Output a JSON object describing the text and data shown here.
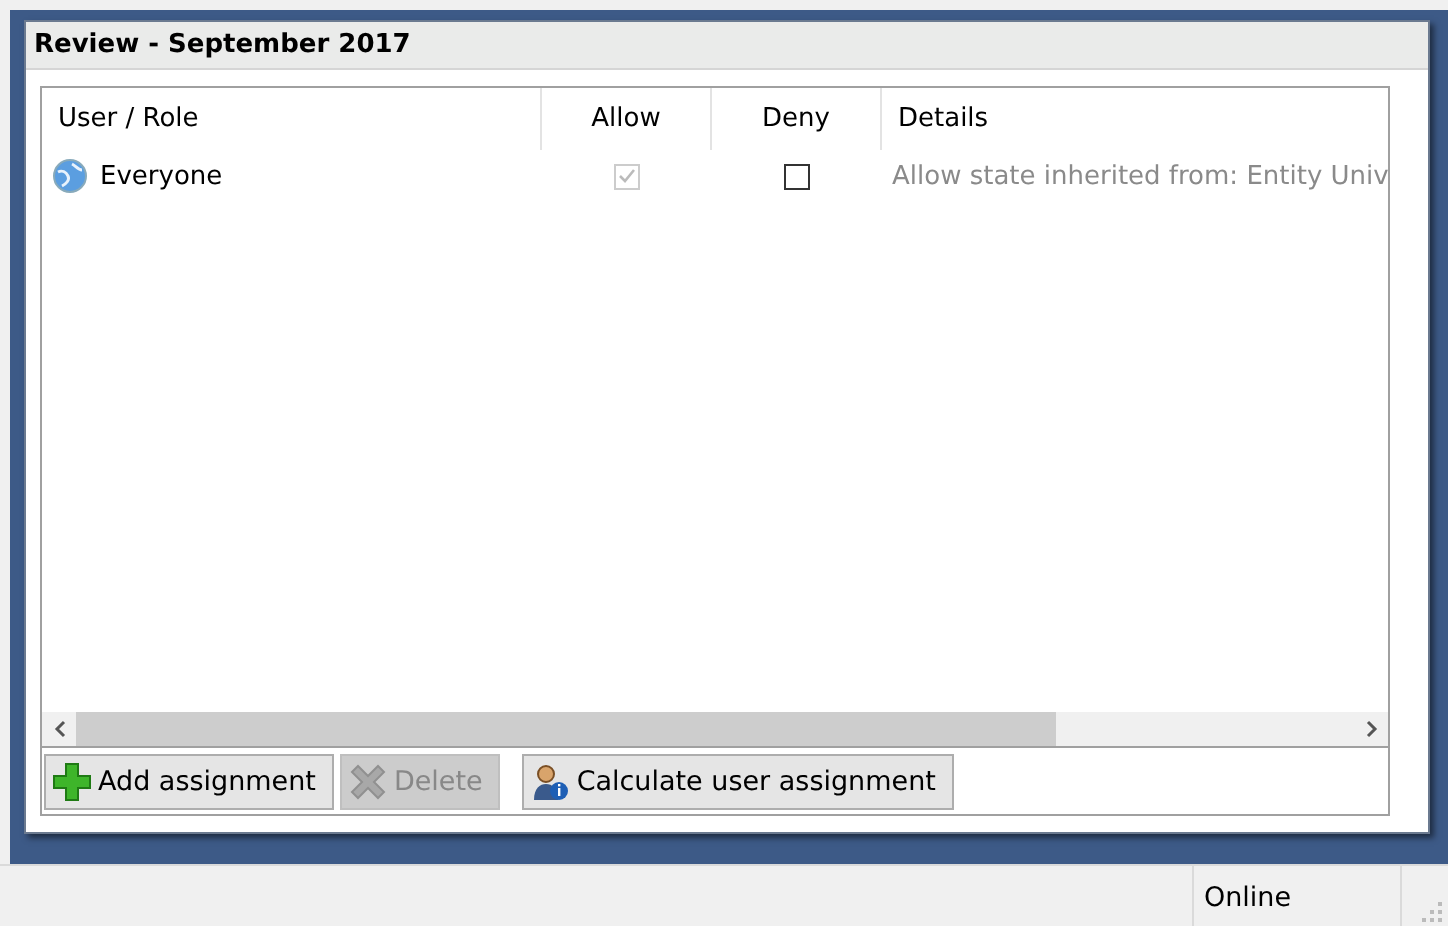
{
  "window": {
    "title": "Review - September 2017"
  },
  "table": {
    "columns": [
      "User / Role",
      "Allow",
      "Deny",
      "Details"
    ],
    "rows": [
      {
        "name": "Everyone",
        "allow": {
          "checked": true,
          "disabled": true
        },
        "deny": {
          "checked": false,
          "disabled": false
        },
        "details": "Allow state inherited from: Entity Univ"
      }
    ]
  },
  "buttons": [
    {
      "kind": "add",
      "label": "Add assignment",
      "disabled": false
    },
    {
      "kind": "delete",
      "label": "Delete",
      "disabled": true
    },
    {
      "kind": "calculate",
      "label": "Calculate user assignment",
      "disabled": false
    }
  ],
  "status_bar": {
    "status": "Online"
  }
}
